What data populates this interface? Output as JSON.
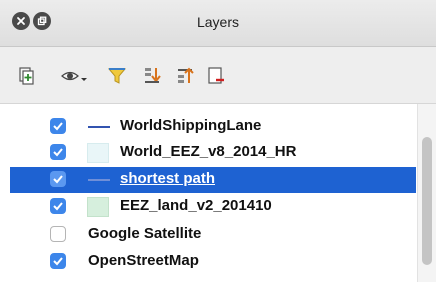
{
  "window": {
    "title": "Layers"
  },
  "toolbar": {
    "buttons": [
      {
        "icon": "add-group-icon"
      },
      {
        "icon": "eye-manage-visibility-icon"
      },
      {
        "icon": "filter-legend-icon"
      },
      {
        "icon": "expand-all-icon"
      },
      {
        "icon": "collapse-all-icon"
      },
      {
        "icon": "remove-layer-icon"
      }
    ]
  },
  "layers": [
    {
      "name": "WorldShippingLane",
      "checked": true,
      "symbol": "line",
      "color": "#3254b0"
    },
    {
      "name": "World_EEZ_v8_2014_HR",
      "checked": true,
      "symbol": "polygon",
      "color": "#e9f6f8"
    },
    {
      "name": "shortest path",
      "checked": true,
      "symbol": "line",
      "color": "#6f8fd8",
      "selected": true
    },
    {
      "name": "EEZ_land_v2_201410",
      "checked": true,
      "symbol": "polygon",
      "color": "#d6efdd"
    },
    {
      "name": "Google Satellite",
      "checked": false
    },
    {
      "name": "OpenStreetMap",
      "checked": true
    }
  ],
  "colors": {
    "selection": "#1e62d2",
    "checkbox": "#3d86ea"
  }
}
